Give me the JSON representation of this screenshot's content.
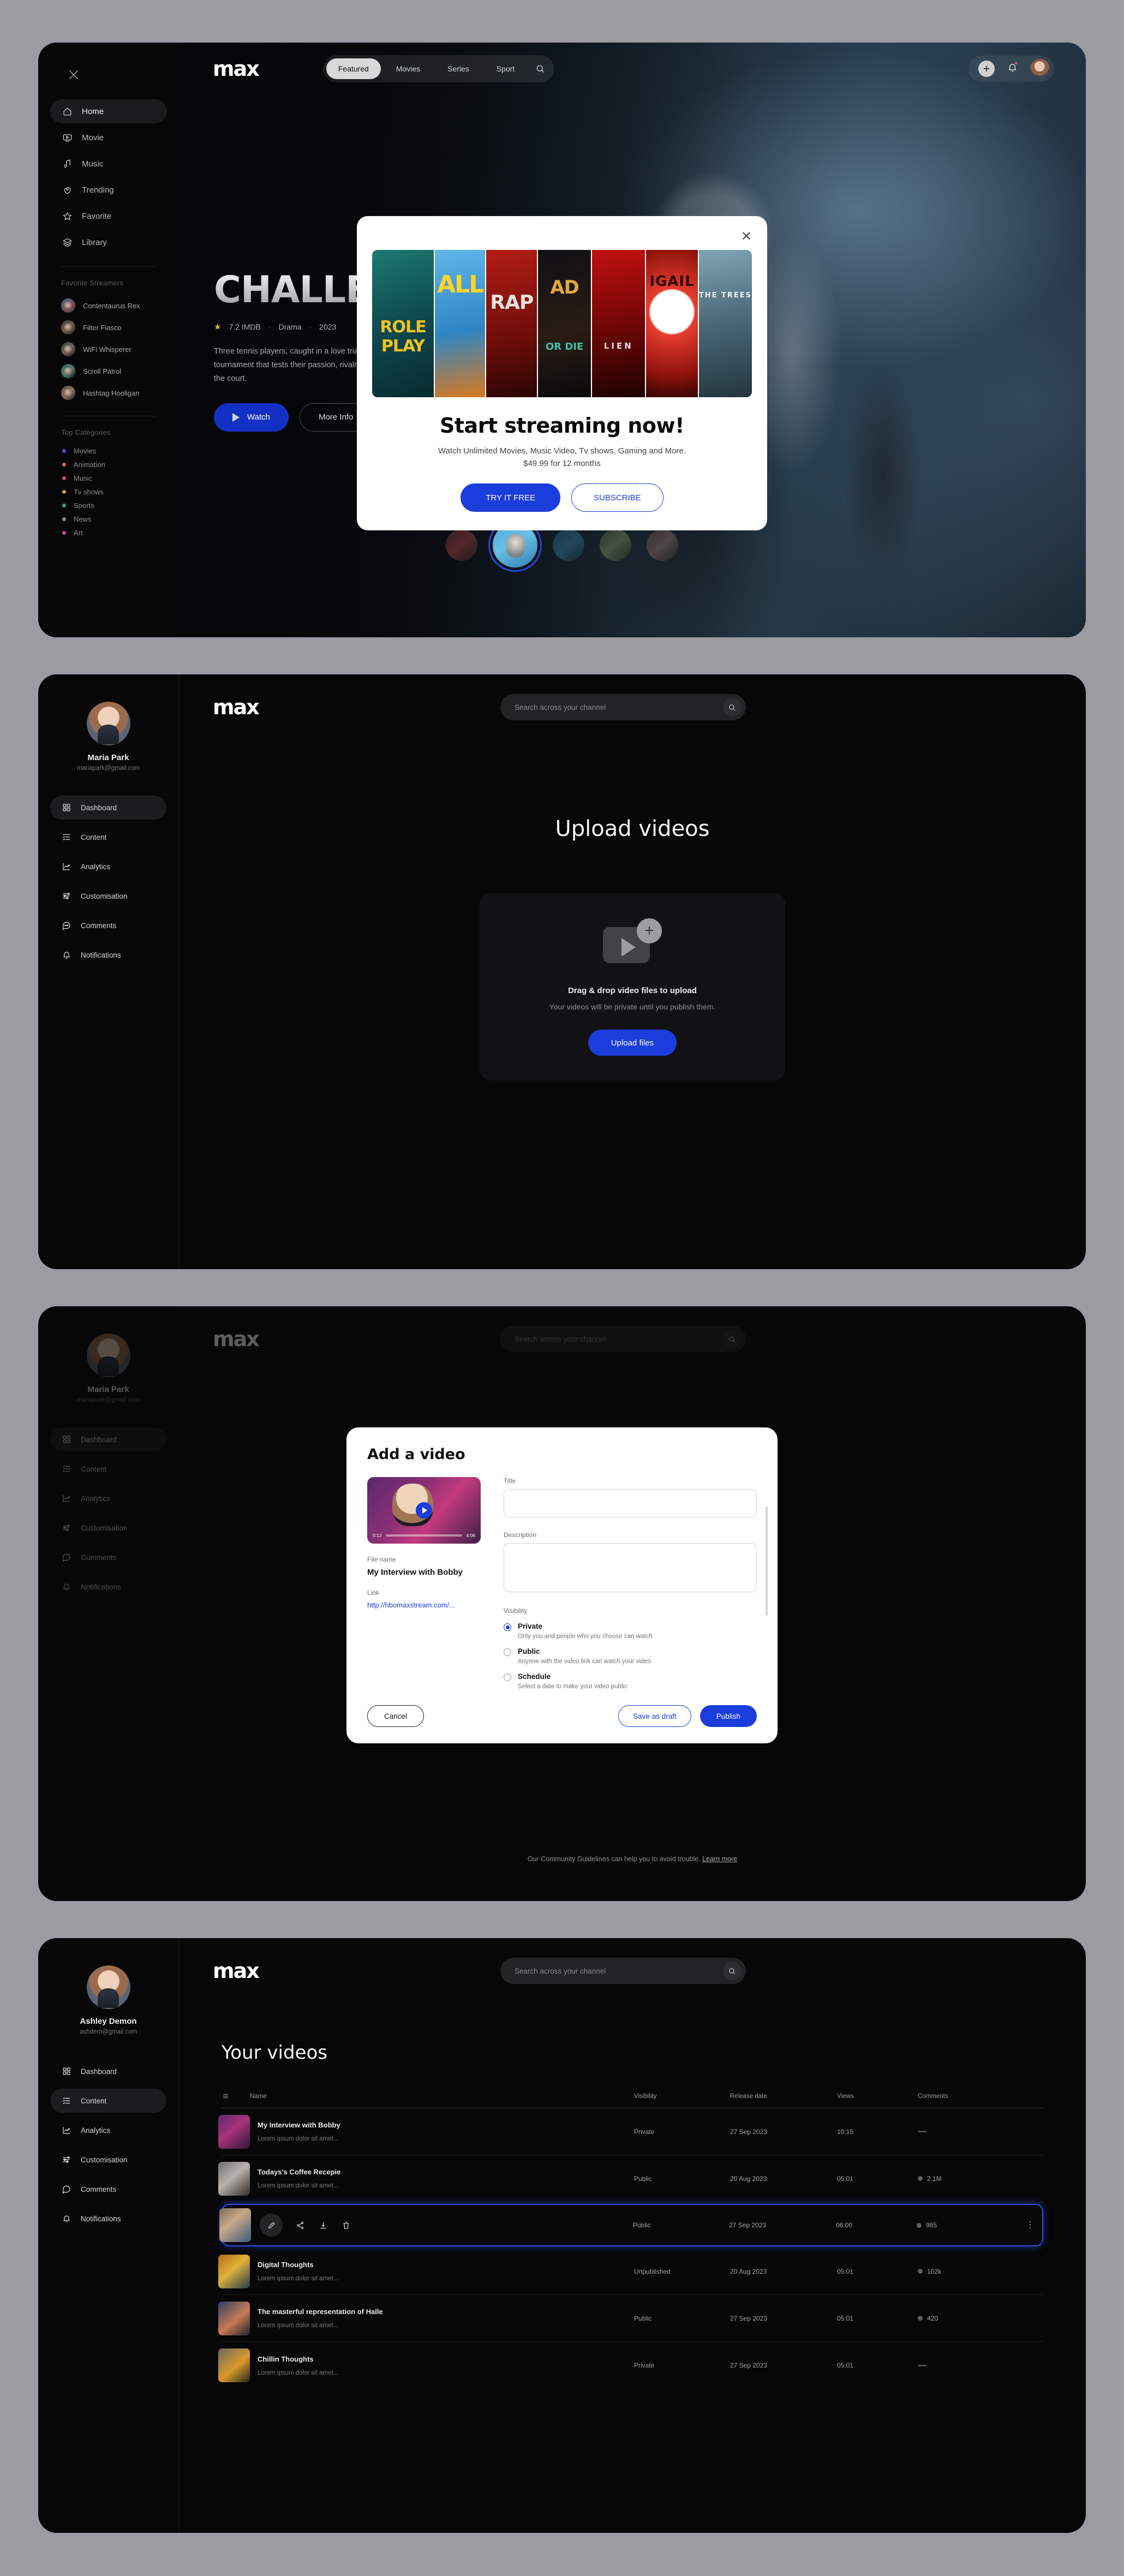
{
  "brand": {
    "logo": "max"
  },
  "screen1": {
    "sidebar": {
      "close_icon": "close-icon",
      "nav": [
        {
          "label": "Home",
          "icon": "home-icon",
          "active": true
        },
        {
          "label": "Movie",
          "icon": "movie-icon",
          "active": false
        },
        {
          "label": "Music",
          "icon": "music-icon",
          "active": false
        },
        {
          "label": "Trending",
          "icon": "trending-icon",
          "active": false
        },
        {
          "label": "Favorite",
          "icon": "star-icon",
          "active": false
        },
        {
          "label": "Library",
          "icon": "library-icon",
          "active": false
        }
      ],
      "streamers_title": "Favorite Streamers",
      "streamers": [
        {
          "name": "Contentaurus Rex"
        },
        {
          "name": "Filter Fiasco"
        },
        {
          "name": "WiFi Whisperer"
        },
        {
          "name": "Scroll Patrol"
        },
        {
          "name": "Hashtag Hooligan"
        }
      ],
      "categories_title": "Top Categories",
      "categories": [
        {
          "label": "Movies",
          "color": "#5b4be0"
        },
        {
          "label": "Animation",
          "color": "#d86a4a"
        },
        {
          "label": "Music",
          "color": "#d14b63"
        },
        {
          "label": "Tv shows",
          "color": "#d6a227"
        },
        {
          "label": "Sports",
          "color": "#2faa6d"
        },
        {
          "label": "News",
          "color": "#8b8b90"
        },
        {
          "label": "Art",
          "color": "#d04a9c"
        }
      ]
    },
    "topbar": {
      "tabs": [
        {
          "label": "Featured",
          "active": true
        },
        {
          "label": "Movies",
          "active": false
        },
        {
          "label": "Series",
          "active": false
        },
        {
          "label": "Sport",
          "active": false
        }
      ],
      "search_icon": "search-icon",
      "add_icon": "plus-icon",
      "bell_icon": "bell-icon",
      "avatar": "user-avatar"
    },
    "hero": {
      "title": "CHALLENGERS",
      "rating": "7.2 IMDB",
      "genre": "Drama",
      "year": "2023",
      "description": "Three tennis players, caught in a love triangle, compete in a high stakes tournament that tests their passion, rivalries, and loyalties both on and off the court.",
      "watch_label": "Watch",
      "info_label": "More Info"
    },
    "modal": {
      "close_icon": "close-icon",
      "posters": [
        "ROLE PLAY",
        "FALL GUY",
        "TRAP",
        "BAD BOYS: RIDE OR DIE",
        "ALIEN: ROMULUS",
        "ABIGAIL",
        "THE TREES"
      ],
      "heading": "Start streaming now!",
      "sub1": "Watch Unlimited Movies, Music Video, Tv shows, Gaming and More.",
      "sub2": "$49.99 for 12 months",
      "try_label": "TRY IT FREE",
      "subscribe_label": "SUBSCRIBE"
    }
  },
  "screen2": {
    "user": {
      "name": "Maria Park",
      "email": "mariapark@gmail.com"
    },
    "nav": [
      {
        "label": "Dashboard",
        "icon": "grid-icon",
        "active": true
      },
      {
        "label": "Content",
        "icon": "list-icon",
        "active": false
      },
      {
        "label": "Analytics",
        "icon": "analytics-icon",
        "active": false
      },
      {
        "label": "Customisation",
        "icon": "sliders-icon",
        "active": false
      },
      {
        "label": "Comments",
        "icon": "comment-icon",
        "active": false
      },
      {
        "label": "Notifications",
        "icon": "bell-icon",
        "active": false
      }
    ],
    "search": {
      "placeholder": "Search across your channel",
      "value": "",
      "icon": "search-icon"
    },
    "title": "Upload videos",
    "drop_icon": "video-add-icon",
    "drop_heading": "Drag & drop video files to upload",
    "drop_sub": "Your videos will be private until you publish them.",
    "upload_label": "Upload files"
  },
  "screen3": {
    "user": {
      "name": "Maria Park",
      "email": "mariapark@gmail.com"
    },
    "nav": [
      {
        "label": "Dashboard",
        "icon": "grid-icon",
        "active": true
      },
      {
        "label": "Content",
        "icon": "list-icon",
        "active": false
      },
      {
        "label": "Analytics",
        "icon": "analytics-icon",
        "active": false
      },
      {
        "label": "Customisation",
        "icon": "sliders-icon",
        "active": false
      },
      {
        "label": "Comments",
        "icon": "comment-icon",
        "active": false
      },
      {
        "label": "Notifications",
        "icon": "bell-icon",
        "active": false
      }
    ],
    "search": {
      "placeholder": "Search across your channel",
      "value": "",
      "icon": "search-icon"
    },
    "modal": {
      "title": "Add a video",
      "video": {
        "current_time": "0:12",
        "duration": "4:06",
        "play_icon": "play-icon"
      },
      "filename_label": "File name",
      "filename_value": "My Interview with Bobby",
      "link_label": "Link",
      "link_value": "http://hbomaxstream.com/...",
      "title_label": "Title",
      "title_value": "",
      "desc_label": "Description",
      "desc_value": "",
      "visibility_label": "Visibility",
      "options": [
        {
          "label": "Private",
          "desc": "Only you and people who you choose can watch",
          "selected": true
        },
        {
          "label": "Public",
          "desc": "Anyone with the video link can watch your video",
          "selected": false
        },
        {
          "label": "Schedule",
          "desc": "Select a date to make your video public",
          "selected": false
        }
      ],
      "cancel_label": "Cancel",
      "draft_label": "Save as draft",
      "publish_label": "Publish"
    },
    "footer_text": "Our Community Guidelines can help you to avoid trouble.",
    "footer_link": "Learn more"
  },
  "screen4": {
    "user": {
      "name": "Ashley Demon",
      "email": "ashdem@gmail.com"
    },
    "nav": [
      {
        "label": "Dashboard",
        "icon": "grid-icon",
        "active": false
      },
      {
        "label": "Content",
        "icon": "list-icon",
        "active": true
      },
      {
        "label": "Analytics",
        "icon": "analytics-icon",
        "active": false
      },
      {
        "label": "Customisation",
        "icon": "sliders-icon",
        "active": false
      },
      {
        "label": "Comments",
        "icon": "comment-icon",
        "active": false
      },
      {
        "label": "Notifications",
        "icon": "bell-icon",
        "active": false
      }
    ],
    "search": {
      "placeholder": "Search across your channel",
      "value": "",
      "icon": "search-icon"
    },
    "title": "Your videos",
    "columns": {
      "filter_icon": "filter-icon",
      "name": "Name",
      "visibility": "Visibility",
      "release_date": "Release date",
      "views": "Views",
      "comments": "Comments"
    },
    "rows": [
      {
        "name": "My Interview with Bobby",
        "sub": "Lorem ipsum dolor sit amet...",
        "visibility": "Private",
        "date": "27 Sep 2023",
        "views": "10:15",
        "comments": "—",
        "has_dot": false,
        "selected": false
      },
      {
        "name": "Todays's Coffee Recepie",
        "sub": "Lorem ipsum dolor sit amet...",
        "visibility": "Public",
        "date": "20 Aug 2023",
        "views": "05:01",
        "comments": "2.1M",
        "has_dot": true,
        "selected": false
      },
      {
        "name": "",
        "sub": "",
        "visibility": "Public",
        "date": "27 Sep 2023",
        "views": "06:00",
        "comments": "985",
        "has_dot": true,
        "selected": true
      },
      {
        "name": "Digital Thoughts",
        "sub": "Lorem ipsum dolor sit amet...",
        "visibility": "Unpublished",
        "date": "20 Aug 2023",
        "views": "05:01",
        "comments": "102k",
        "has_dot": true,
        "selected": false
      },
      {
        "name": "The masterful representation of Halle",
        "sub": "Lorem ipsum dolor sit amet...",
        "visibility": "Public",
        "date": "27 Sep 2023",
        "views": "05:01",
        "comments": "420",
        "has_dot": true,
        "selected": false
      },
      {
        "name": "Chillin Thoughts",
        "sub": "Lorem ipsum dolor sit amet...",
        "visibility": "Private",
        "date": "27 Sep 2023",
        "views": "05:01",
        "comments": "—",
        "has_dot": false,
        "selected": false
      }
    ],
    "row_actions": [
      {
        "icon": "edit-icon",
        "name": "edit"
      },
      {
        "icon": "share-icon",
        "name": "share"
      },
      {
        "icon": "download-icon",
        "name": "download"
      },
      {
        "icon": "delete-icon",
        "name": "delete"
      }
    ],
    "kebab_icon": "more-vertical-icon"
  },
  "colors": {
    "accent": "#1a3ddb",
    "page_bg": "#9b9ba2",
    "screen_bg": "#070707"
  }
}
